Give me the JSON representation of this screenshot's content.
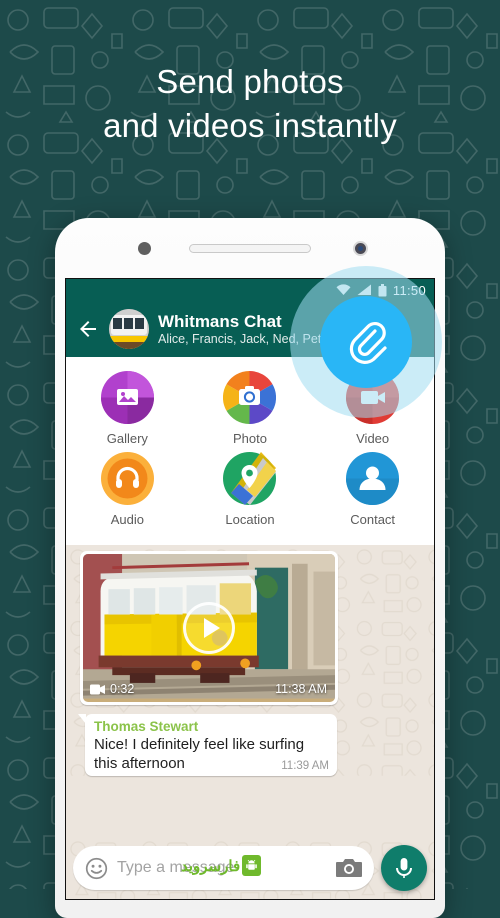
{
  "promo": {
    "headline_line1": "Send photos",
    "headline_line2": "and videos instantly",
    "background_color": "#1d4a4a",
    "text_color": "#ffffff"
  },
  "phone": {
    "sensor_icon": "proximity-sensor",
    "earpiece_icon": "earpiece-speaker",
    "camera_icon": "front-camera"
  },
  "status_bar": {
    "wifi_icon": "wifi-icon",
    "signal_icon": "signal-icon",
    "battery_icon": "battery-icon",
    "time": "11:50",
    "background_color": "#075e54"
  },
  "app_bar": {
    "back_icon": "back-arrow-icon",
    "avatar_icon": "group-avatar",
    "title": "Whitmans Chat",
    "subtitle": "Alice, Francis, Jack, Ned, Peter",
    "background_color": "#075e54"
  },
  "attach_panel": {
    "rows": [
      [
        {
          "label": "Gallery",
          "icon": "gallery-icon",
          "color": "#b141cd"
        },
        {
          "label": "Photo",
          "icon": "camera-icon",
          "color": "#e8453c"
        },
        {
          "label": "Video",
          "icon": "video-icon",
          "color": "#e03b35"
        }
      ],
      [
        {
          "label": "Audio",
          "icon": "headphones-icon",
          "color": "#f59f1b"
        },
        {
          "label": "Location",
          "icon": "map-pin-icon",
          "color": "#1fa463"
        },
        {
          "label": "Contact",
          "icon": "person-icon",
          "color": "#2196d6"
        }
      ]
    ]
  },
  "attach_highlight": {
    "icon": "paperclip-icon",
    "inner_color": "#29b6f6",
    "outer_color": "rgba(160,220,240,.55)"
  },
  "messages": [
    {
      "type": "video",
      "thumbnail": "yellow-tram-photo",
      "play_icon": "play-icon",
      "duration_icon": "video-camera-icon",
      "duration": "0:32",
      "time": "11:38 AM"
    },
    {
      "type": "text",
      "sender": "Thomas Stewart",
      "sender_color": "#8bc34a",
      "text": "Nice! I definitely feel like surfing this afternoon",
      "time": "11:39 AM"
    }
  ],
  "input_bar": {
    "emoji_icon": "emoji-icon",
    "placeholder": "Type a message",
    "camera_icon": "camera-icon",
    "mic_icon": "microphone-icon",
    "mic_color": "#0f7d6b"
  },
  "watermark": {
    "text": "فارسروید",
    "logo_icon": "android-box-logo",
    "color": "#6fb92c"
  }
}
